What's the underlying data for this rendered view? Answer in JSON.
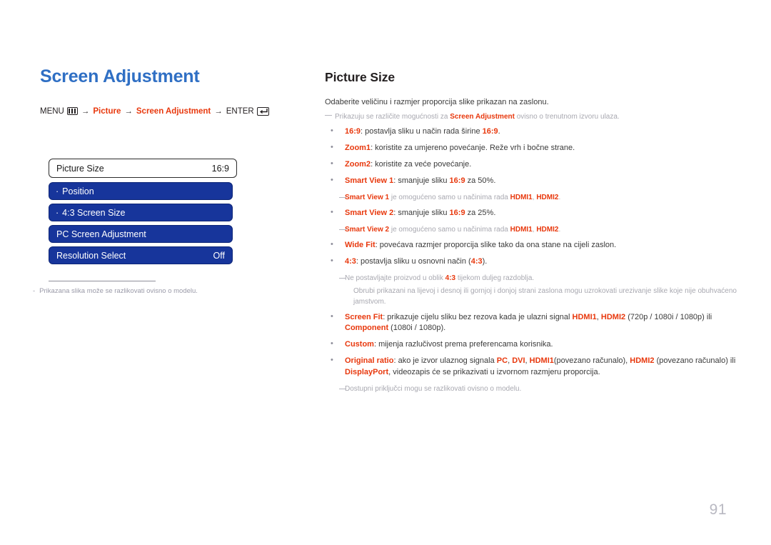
{
  "chapter": {
    "title": "Screen Adjustment"
  },
  "breadcrumb": {
    "menu_label": "MENU",
    "menu_icon": "menu-bars-icon",
    "arrow": "→",
    "picture_label": "Picture",
    "screen_adjustment_label": "Screen Adjustment",
    "enter_label": "ENTER",
    "enter_icon": "enter-return-icon"
  },
  "osd": {
    "rows": [
      {
        "label": "Picture Size",
        "value": "16:9",
        "style": "head",
        "bullet": ""
      },
      {
        "label": "Position",
        "value": "",
        "style": "item",
        "bullet": "·"
      },
      {
        "label": "4:3 Screen Size",
        "value": "",
        "style": "item",
        "bullet": "·"
      },
      {
        "label": "PC Screen Adjustment",
        "value": "",
        "style": "item",
        "bullet": ""
      },
      {
        "label": "Resolution Select",
        "value": "Off",
        "style": "item",
        "bullet": ""
      }
    ]
  },
  "left_note": {
    "dash": "-",
    "text": "Prikazana slika može se razlikovati ovisno o modelu."
  },
  "section": {
    "title": "Picture Size",
    "intro": "Odaberite veličinu i razmjer proporcija slike prikazan na zaslonu.",
    "intro_note": {
      "dash": "—",
      "before": "Prikazuju se različite mogućnosti za ",
      "keyword": "Screen Adjustment",
      "after": " ovisno o trenutnom izvoru ulaza."
    }
  },
  "bullets": {
    "b1": {
      "kw": "16:9",
      "text_a": ": postavlja sliku u način rada širine ",
      "kw2": "16:9",
      "text_b": "."
    },
    "b2": {
      "kw": "Zoom1",
      "text_a": ": koristite za umjereno povećanje. Reže vrh i bočne strane."
    },
    "b3": {
      "kw": "Zoom2",
      "text_a": ": koristite za veće povećanje."
    },
    "b4": {
      "kw": "Smart View 1",
      "text_a": ": smanjuje sliku ",
      "kw2": "16:9",
      "text_b": " za 50%."
    },
    "n4": {
      "dash": "—",
      "kw": "Smart View 1",
      "text_a": " je omogućeno samo u načinima rada ",
      "kw2": "HDMI1",
      "sep": ", ",
      "kw3": "HDMI2",
      "text_b": "."
    },
    "b5": {
      "kw": "Smart View 2",
      "text_a": ": smanjuje sliku ",
      "kw2": "16:9",
      "text_b": " za 25%."
    },
    "n5": {
      "dash": "—",
      "kw": "Smart View 2",
      "text_a": " je omogućeno samo u načinima rada ",
      "kw2": "HDMI1",
      "sep": ", ",
      "kw3": "HDMI2",
      "text_b": "."
    },
    "b6": {
      "kw": "Wide Fit",
      "text_a": ": povećava razmjer proporcija slike tako da ona stane na cijeli zaslon."
    },
    "b7": {
      "kw": "4:3",
      "text_a": ": postavlja sliku u osnovni način (",
      "kw2": "4:3",
      "text_b": ")."
    },
    "n7": {
      "dash": "—",
      "text_a": "Ne postavljajte proizvod u oblik ",
      "kw": "4:3",
      "text_b": " tijekom duljeg razdoblja."
    },
    "n7b": {
      "text": "Obrubi prikazani na lijevoj i desnoj ili gornjoj i donjoj strani zaslona mogu uzrokovati urezivanje slike koje nije obuhvaćeno jamstvom."
    },
    "b8": {
      "kw": "Screen Fit",
      "text_a": ": prikazuje cijelu sliku bez rezova kada je ulazni signal ",
      "kw2": "HDMI1",
      "sep": ", ",
      "kw3": "HDMI2",
      "text_b": " (720p / 1080i / 1080p) ili ",
      "kw4": "Component",
      "text_c": " (1080i / 1080p)."
    },
    "b9": {
      "kw": "Custom",
      "text_a": ": mijenja razlučivost prema preferencama korisnika."
    },
    "b10": {
      "kw": "Original ratio",
      "text_a": ": ako je izvor ulaznog signala ",
      "kw2": "PC",
      "sep1": ", ",
      "kw3": "DVI",
      "sep2": ", ",
      "kw4": "HDMI1",
      "text_b": "(povezano računalo), ",
      "kw5": "HDMI2",
      "text_c": " (povezano računalo) ili ",
      "kw6": "DisplayPort",
      "text_d": ", videozapis će se prikazivati u izvornom razmjeru proporcija."
    },
    "n10": {
      "dash": "—",
      "text": "Dostupni priključci mogu se razlikovati ovisno o modelu."
    }
  },
  "footer": {
    "page_number": "91"
  },
  "colors": {
    "accent_red": "#e8380d",
    "title_blue": "#2f6fc4",
    "osd_blue": "#17359b",
    "note_gray": "#a8a8b0"
  }
}
